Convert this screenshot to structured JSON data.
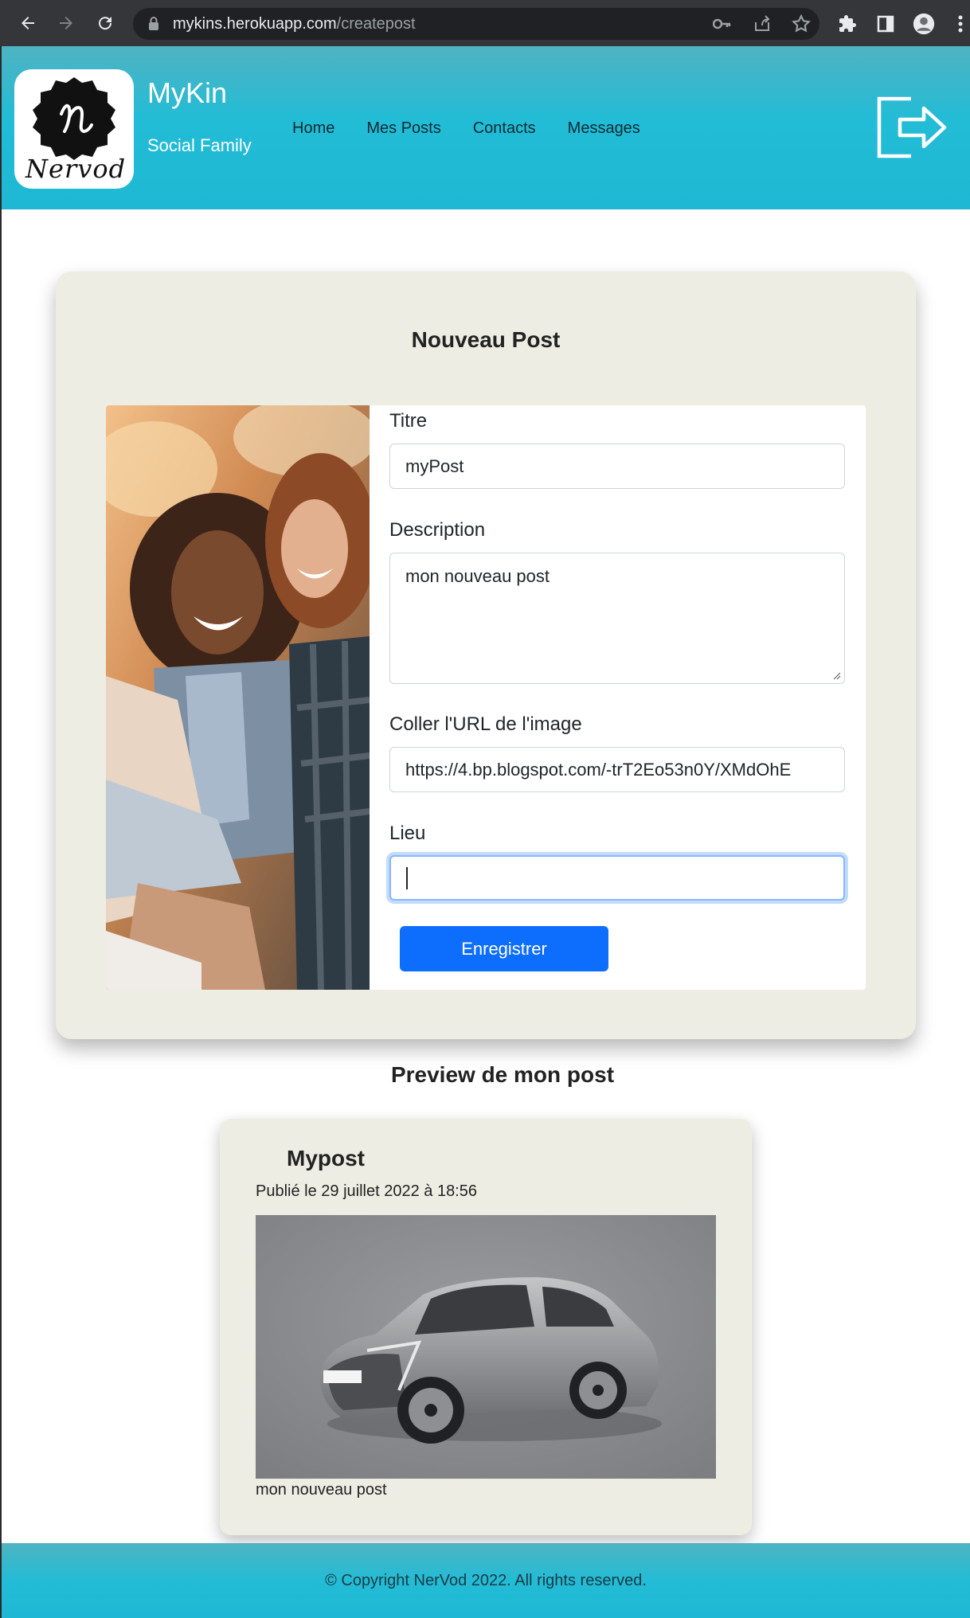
{
  "browser": {
    "url_host": "mykins.herokuapp.com",
    "url_path": "/createpost"
  },
  "header": {
    "brand": "MyKin",
    "tagline": "Social Family",
    "logo_text": "Nervod",
    "nav": [
      "Home",
      "Mes Posts",
      "Contacts",
      "Messages"
    ]
  },
  "form": {
    "title": "Nouveau Post",
    "titre_label": "Titre",
    "titre_value": "myPost",
    "description_label": "Description",
    "description_value": "mon nouveau post",
    "url_label": "Coller l'URL de l'image",
    "url_value": "https://4.bp.blogspot.com/-trT2Eo53n0Y/XMdOhE",
    "lieu_label": "Lieu",
    "lieu_value": "",
    "submit_label": "Enregistrer"
  },
  "preview": {
    "heading": "Preview de mon post",
    "post_title": "Mypost",
    "post_date": "Publié le 29 juillet 2022 à 18:56",
    "post_description": "mon nouveau post"
  },
  "footer": {
    "copyright": "© Copyright NerVod 2022. All rights reserved."
  },
  "colors": {
    "header_gradient": "#22bcd6",
    "card_bg": "#eeede4",
    "primary_button": "#0d6efd"
  }
}
